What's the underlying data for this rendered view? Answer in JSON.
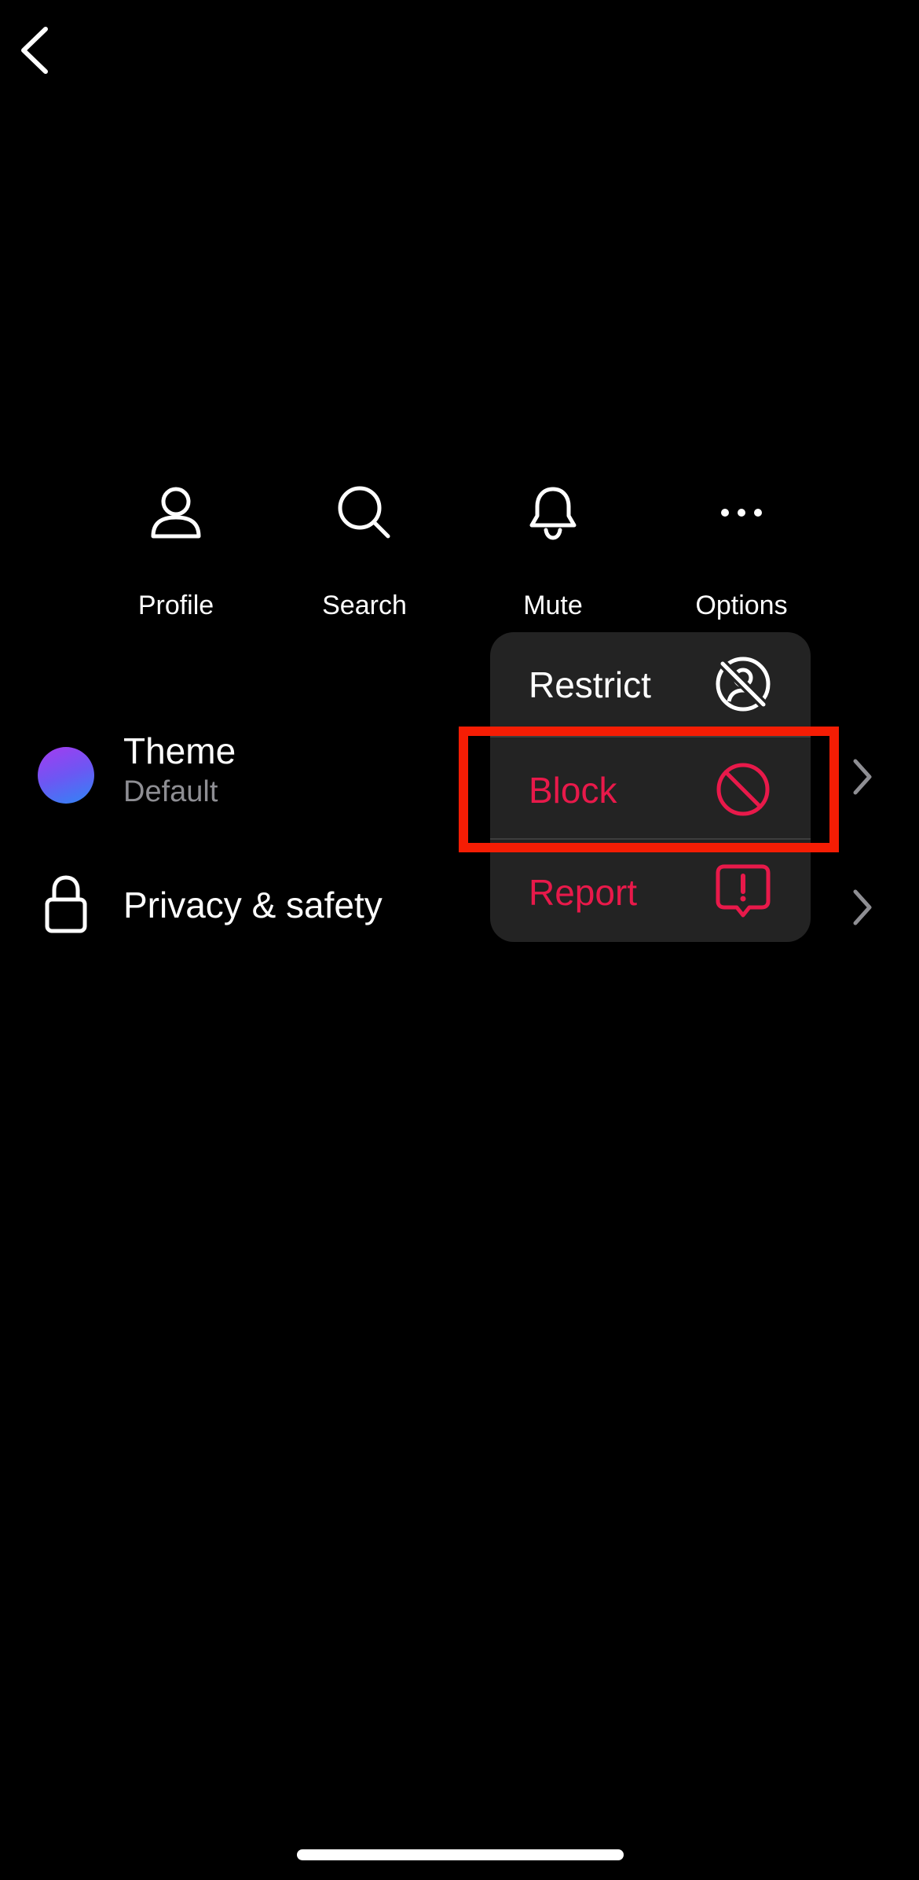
{
  "header": {
    "back_icon": "chevron-left-icon"
  },
  "actions": [
    {
      "label": "Profile",
      "icon": "person-icon"
    },
    {
      "label": "Search",
      "icon": "search-icon"
    },
    {
      "label": "Mute",
      "icon": "bell-icon"
    },
    {
      "label": "Options",
      "icon": "ellipsis-icon"
    }
  ],
  "settings": {
    "theme": {
      "title": "Theme",
      "subtitle": "Default"
    },
    "privacy": {
      "title": "Privacy & safety"
    }
  },
  "menu": {
    "items": [
      {
        "label": "Restrict",
        "icon": "restrict-icon",
        "color": "#ffffff"
      },
      {
        "label": "Block",
        "icon": "block-icon",
        "color": "#e8194a"
      },
      {
        "label": "Report",
        "icon": "report-icon",
        "color": "#e8194a"
      }
    ]
  },
  "colors": {
    "background": "#000000",
    "menu_background": "#232323",
    "destructive": "#e8194a",
    "highlight": "#f51d04",
    "secondary_text": "#8e8e93"
  }
}
